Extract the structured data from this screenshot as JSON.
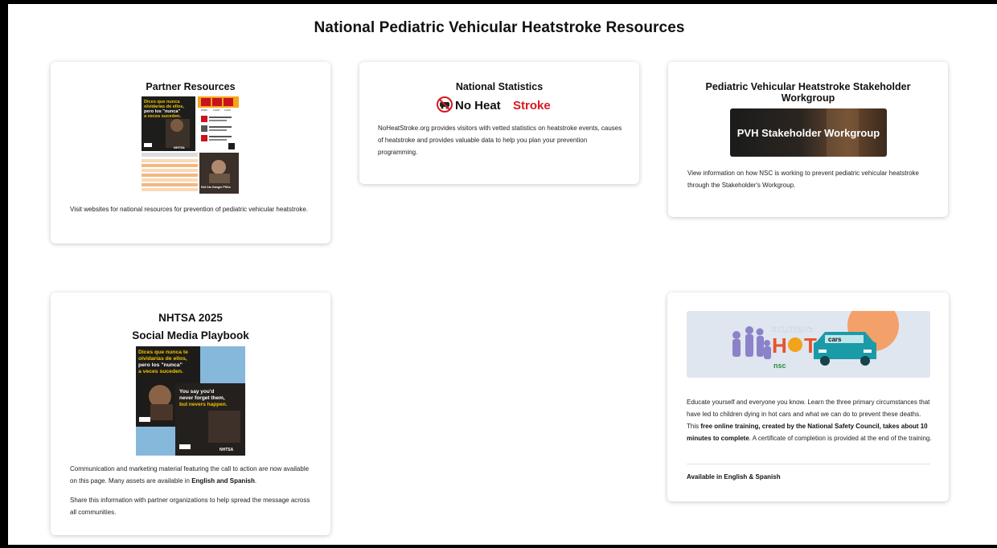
{
  "page": {
    "title": "National Pediatric Vehicular Heatstroke Resources"
  },
  "cards": [
    {
      "title": "Partner Resources",
      "image_text": {
        "spanish_1": "Dices que nunca",
        "spanish_2": "olvidarías de ellos,",
        "spanish_3": "pero los \"nunca\"",
        "spanish_4": "a veces suceden.",
        "look_1": "PARK",
        "look_2": "LOOK",
        "look_3": "LOCK",
        "nhtsa": "NHTSA",
        "psa": "Hot Car Danger PSAs"
      },
      "body": "Visit websites for national resources for prevention of pediatric vehicular heatstroke."
    },
    {
      "title": "National Statistics",
      "logo": {
        "text_black": "No Heat",
        "text_red": "Stroke"
      },
      "body": "NoHeatStroke.org provides visitors with vetted statistics on heatstroke events, causes of heatstroke and provides valuable data to help you plan your prevention programming."
    },
    {
      "title": "Pediatric Vehicular Heatstroke Stakeholder Workgroup",
      "image_label": "PVH Stakeholder Workgroup",
      "body": "View information on how NSC is working to prevent pediatric vehicular heatstroke through the Stakeholder's Workgroup."
    },
    {
      "title_line1": "NHTSA 2025",
      "title_line2": "Social Media Playbook",
      "image_text": {
        "es_1": "Dices que nunca te",
        "es_2": "olvidarías de ellos,",
        "es_3": "pero los \"nunca\"",
        "es_4": "a veces suceden.",
        "en_1": "You say you'd",
        "en_2": "never forget them,",
        "en_3": "but nevers happen.",
        "nhtsa": "NHTSA"
      },
      "body1_a": "Communication and marketing material featuring the call to action are now available on this page. Many assets are available in ",
      "body1_b": "English and Spanish",
      "body1_c": ".",
      "body2": "Share this information with partner organizations to help spread the message across all communities."
    },
    {
      "image_text": {
        "children": "CHILDREN in",
        "hot": "H",
        "hot2": "T",
        "cars": "cars",
        "nsc": "nsc"
      },
      "body_a": "Educate yourself and everyone you know. Learn the three primary circumstances that have led to children dying in hot cars and what we can do to prevent these deaths. This ",
      "body_b": "free online training, created by the National Safety Council, takes about 10 minutes to complete",
      "body_c": ". A certificate of completion is provided at the end of the training.",
      "footer": "Available in English & Spanish"
    }
  ]
}
